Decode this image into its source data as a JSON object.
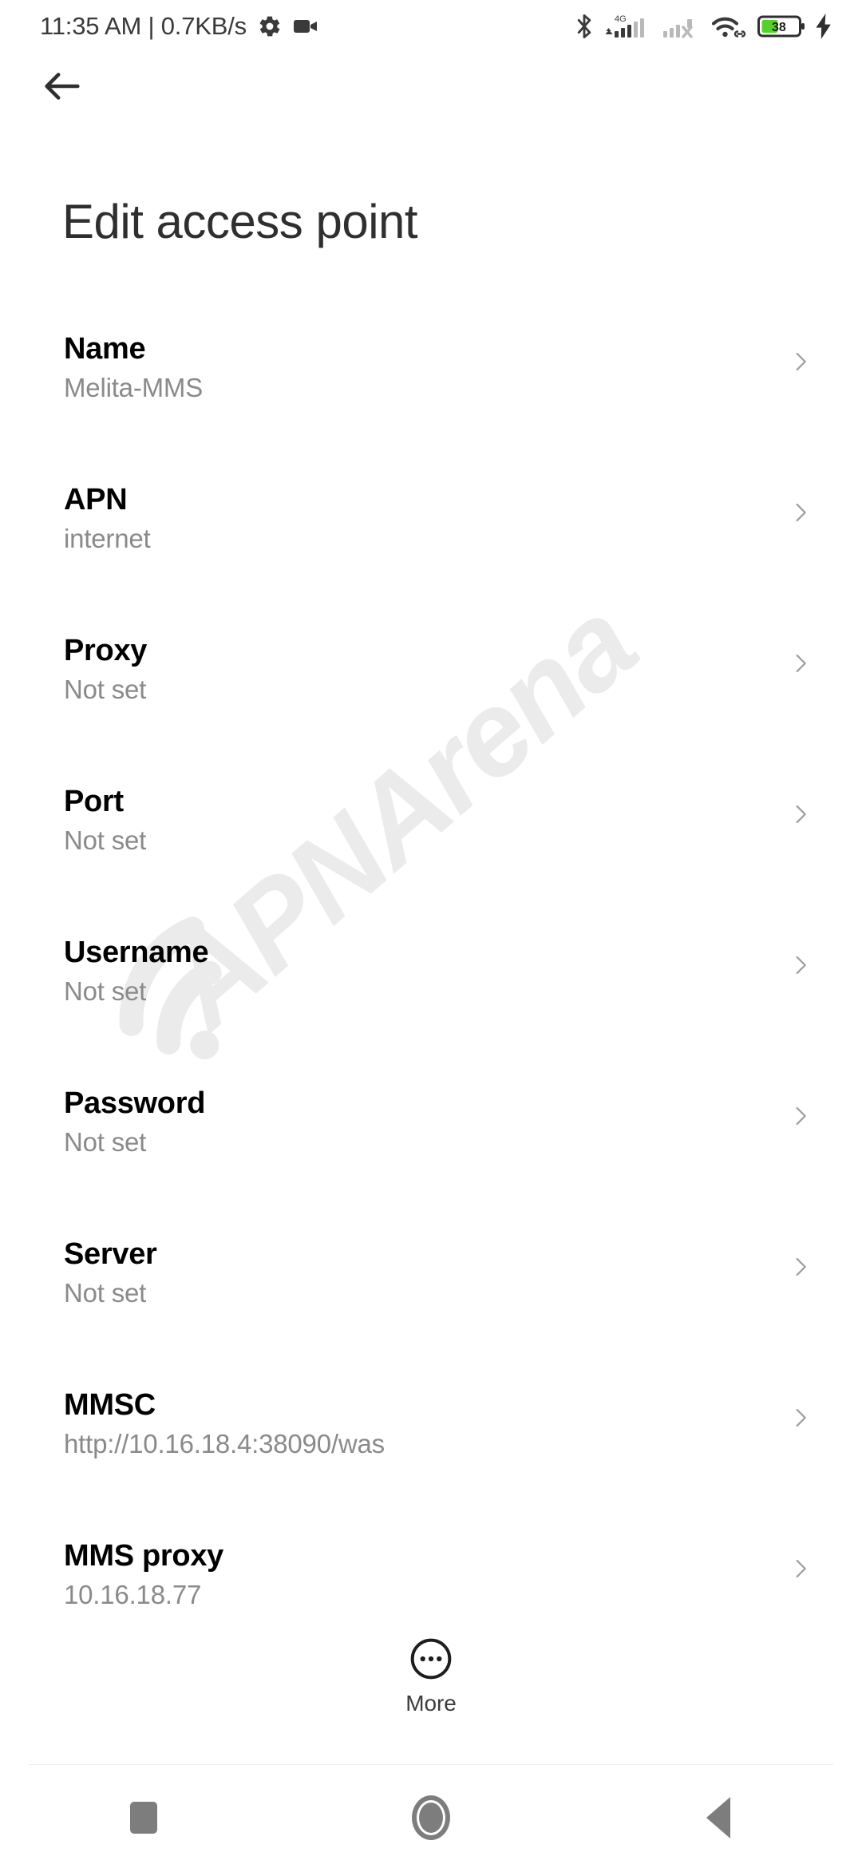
{
  "status_bar": {
    "clock_text": "11:35 AM | 0.7KB/s",
    "icons": [
      "gear-icon",
      "video-camera-icon",
      "bluetooth-icon",
      "mobile-signal-4g-icon",
      "mobile-signal-no-service-icon",
      "wifi-icon",
      "battery-icon",
      "charging-bolt-icon"
    ],
    "network_type": "4G",
    "battery_level": "38"
  },
  "appbar": {
    "back_icon": "arrow-left-icon",
    "title": "Edit access point"
  },
  "watermark": {
    "text": "APNArena",
    "logo_icon": "wifi-signal-icon",
    "color": "#ebebeb"
  },
  "list": {
    "chevron_icon": "chevron-right-icon",
    "chevron_color": "#9e9e9e",
    "items": [
      {
        "title": "Name",
        "value": "Melita-MMS"
      },
      {
        "title": "APN",
        "value": "internet"
      },
      {
        "title": "Proxy",
        "value": "Not set"
      },
      {
        "title": "Port",
        "value": "Not set"
      },
      {
        "title": "Username",
        "value": "Not set"
      },
      {
        "title": "Password",
        "value": "Not set"
      },
      {
        "title": "Server",
        "value": "Not set"
      },
      {
        "title": "MMSC",
        "value": "http://10.16.18.4:38090/was"
      },
      {
        "title": "MMS proxy",
        "value": "10.16.18.77"
      }
    ]
  },
  "more_button": {
    "label": "More",
    "icon": "more-circle-icon"
  },
  "nav_bar": {
    "recents_icon": "square-recents-icon",
    "home_icon": "circle-home-icon",
    "back_icon": "triangle-back-icon",
    "color": "#7d7d7d"
  }
}
